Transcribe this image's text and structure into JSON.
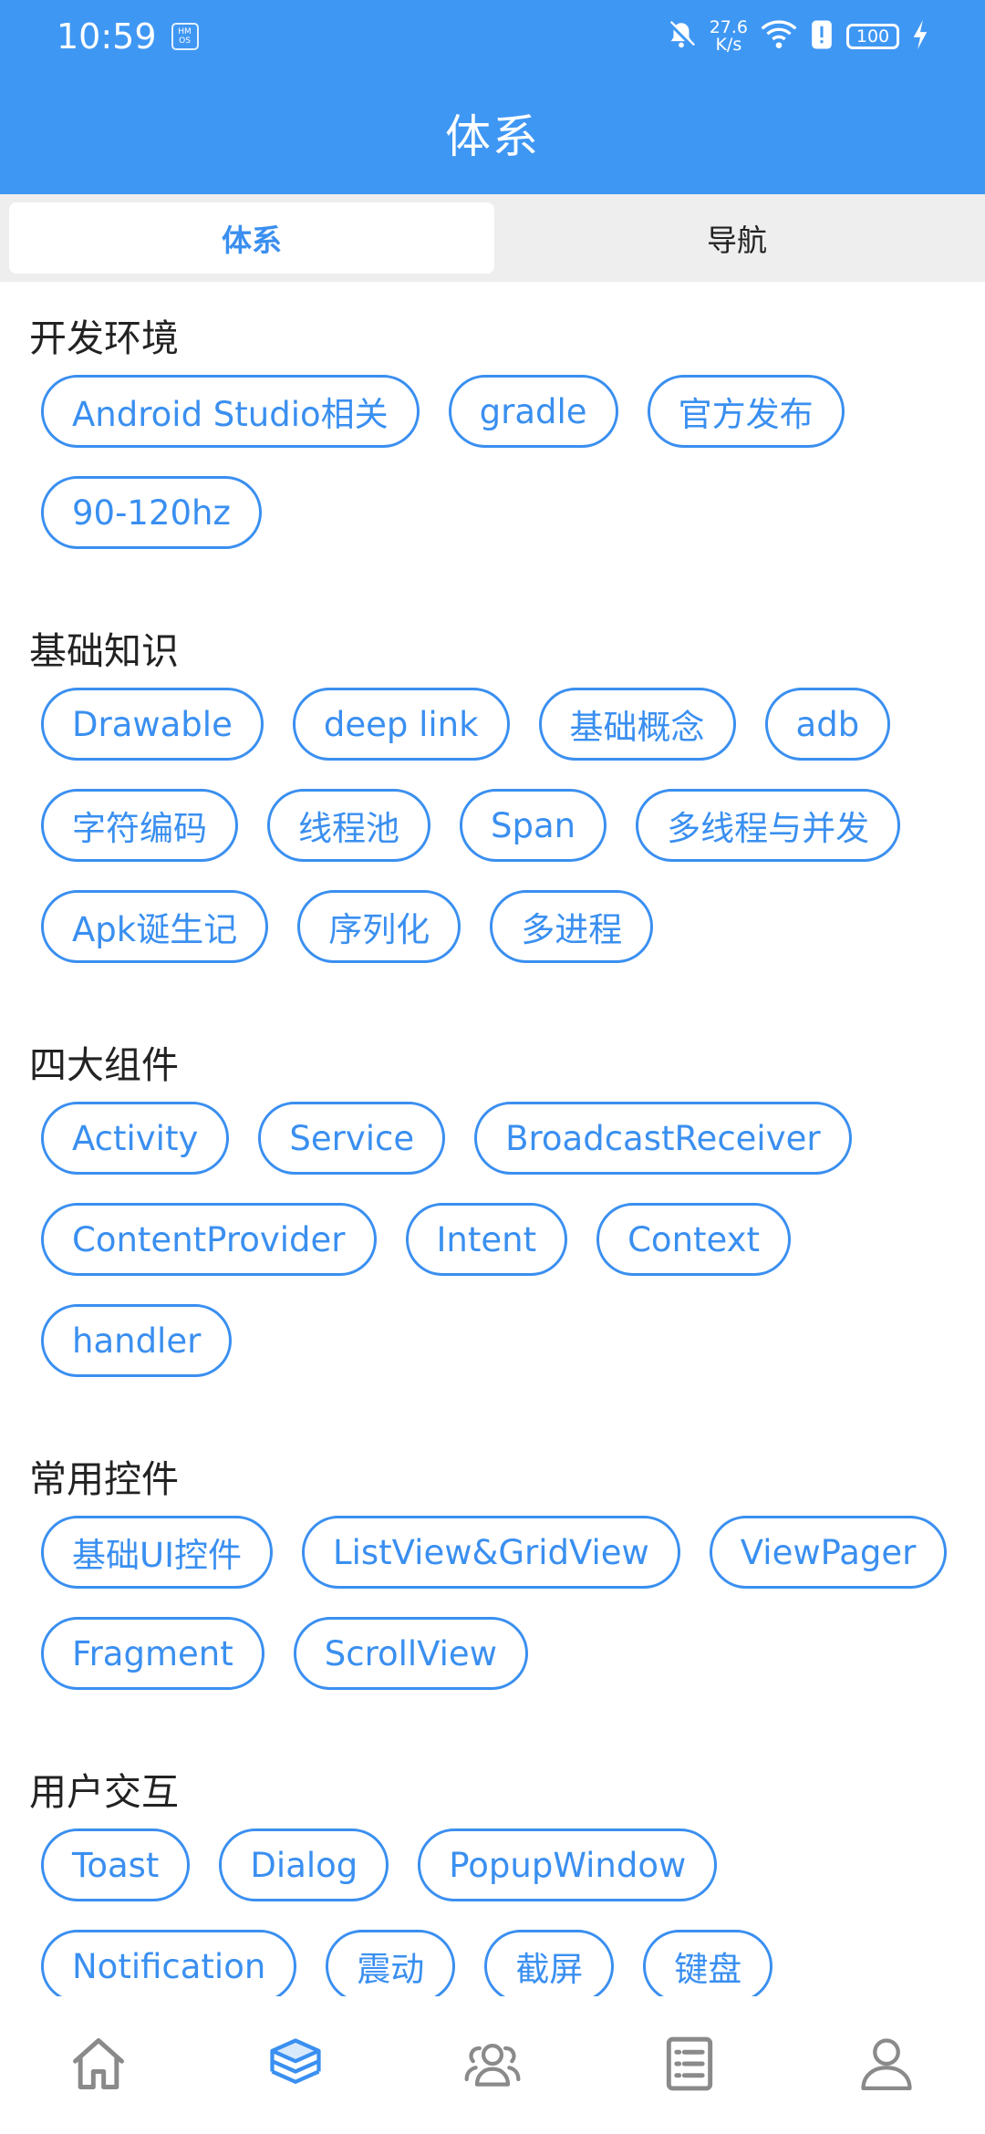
{
  "status_bar": {
    "time": "10:59",
    "os_badge": "HM OS",
    "net_speed_top": "27.6",
    "net_speed_bottom": "K/s",
    "battery": "100"
  },
  "header": {
    "title": "体系"
  },
  "tabs": [
    {
      "label": "体系",
      "active": true
    },
    {
      "label": "导航",
      "active": false
    }
  ],
  "sections": [
    {
      "title": "开发环境",
      "chips": [
        "Android Studio相关",
        "gradle",
        "官方发布",
        "90-120hz"
      ]
    },
    {
      "title": "基础知识",
      "chips": [
        "Drawable",
        "deep link",
        "基础概念",
        "adb",
        "字符编码",
        "线程池",
        "Span",
        "多线程与并发",
        "Apk诞生记",
        "序列化",
        "多进程"
      ]
    },
    {
      "title": "四大组件",
      "chips": [
        "Activity",
        "Service",
        "BroadcastReceiver",
        "ContentProvider",
        "Intent",
        "Context",
        "handler"
      ]
    },
    {
      "title": "常用控件",
      "chips": [
        "基础UI控件",
        "ListView&GridView",
        "ViewPager",
        "Fragment",
        "ScrollView"
      ]
    },
    {
      "title": "用户交互",
      "chips": [
        "Toast",
        "Dialog",
        "PopupWindow",
        "Notification",
        "震动",
        "截屏",
        "键盘"
      ]
    }
  ],
  "bottom_nav": [
    {
      "icon": "home-icon",
      "active": false
    },
    {
      "icon": "layers-icon",
      "active": true
    },
    {
      "icon": "group-icon",
      "active": false
    },
    {
      "icon": "list-icon",
      "active": false
    },
    {
      "icon": "profile-icon",
      "active": false
    }
  ],
  "colors": {
    "primary": "#3f97f4",
    "chip": "#3a8ff0",
    "nav_inactive": "#8a8a8a"
  }
}
